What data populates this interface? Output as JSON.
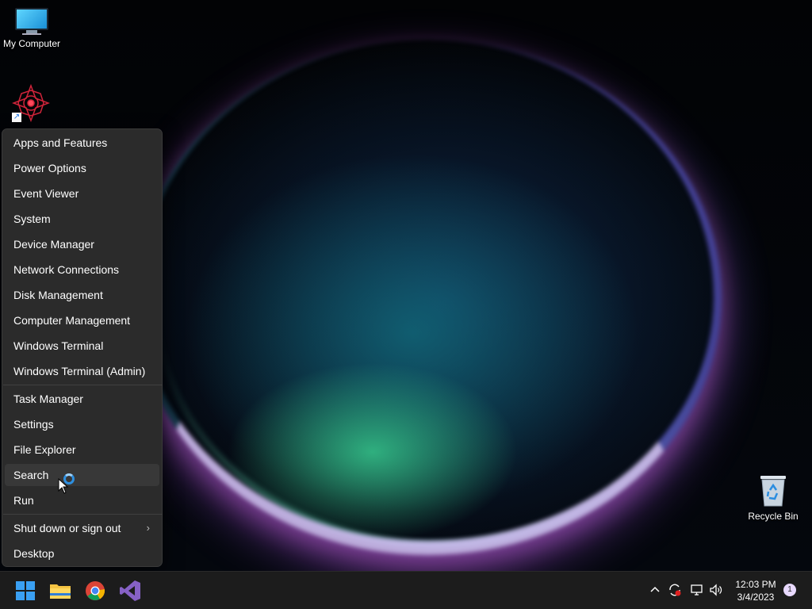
{
  "desktop": {
    "icons": [
      {
        "label": "My Computer"
      },
      {
        "label": "Recycle Bin"
      }
    ]
  },
  "menu": {
    "items": [
      {
        "label": "Apps and Features"
      },
      {
        "label": "Power Options"
      },
      {
        "label": "Event Viewer"
      },
      {
        "label": "System"
      },
      {
        "label": "Device Manager"
      },
      {
        "label": "Network Connections"
      },
      {
        "label": "Disk Management"
      },
      {
        "label": "Computer Management"
      },
      {
        "label": "Windows Terminal"
      },
      {
        "label": "Windows Terminal (Admin)"
      },
      {
        "label": "Task Manager"
      },
      {
        "label": "Settings"
      },
      {
        "label": "File Explorer"
      },
      {
        "label": "Search"
      },
      {
        "label": "Run"
      },
      {
        "label": "Shut down or sign out"
      },
      {
        "label": "Desktop"
      }
    ],
    "submenu_arrow": "›"
  },
  "taskbar": {
    "icons": [
      "windows-start-icon",
      "file-explorer-icon",
      "chrome-icon",
      "visual-studio-icon"
    ],
    "tray": {
      "chevron": "^",
      "time": "12:03 PM",
      "date": "3/4/2023",
      "notification_count": "1"
    }
  },
  "colors": {
    "menu_bg": "#2b2b2b",
    "menu_hover": "#383838",
    "taskbar_bg": "#1c1c1c",
    "accent_blue": "#2d8fe0"
  }
}
